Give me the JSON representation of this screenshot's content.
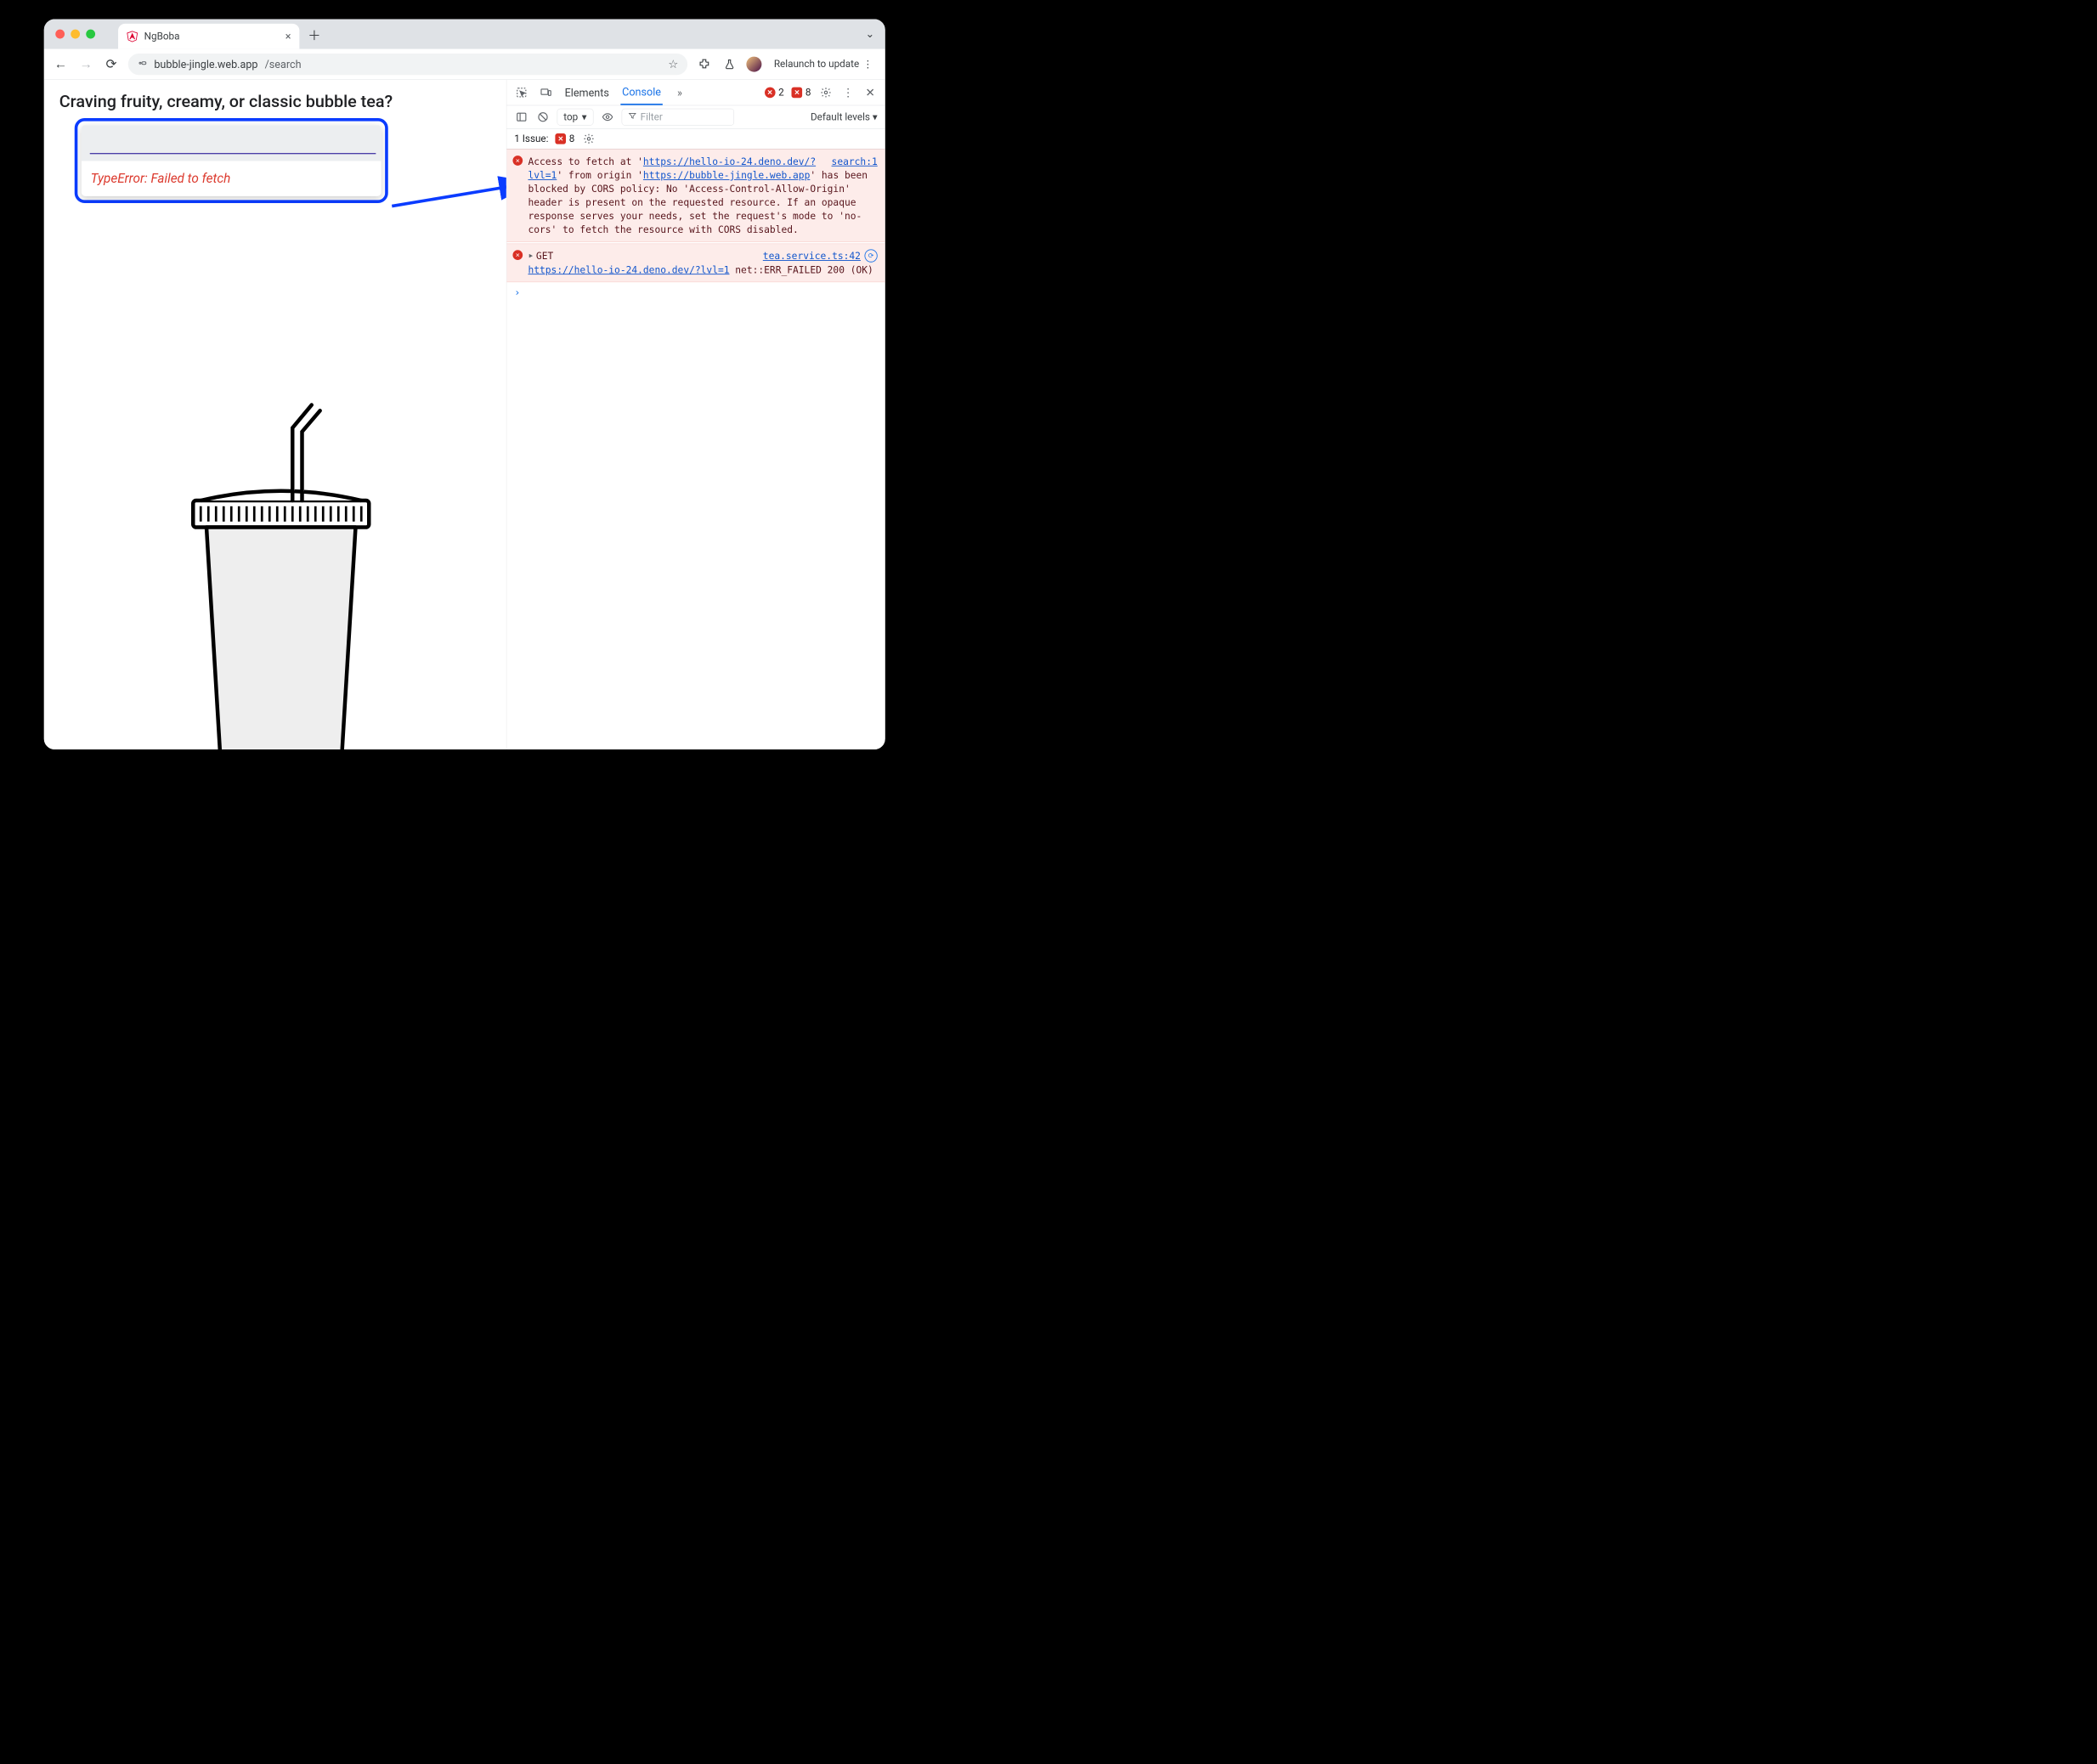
{
  "browser": {
    "tab_title": "NgBoba",
    "url_host": "bubble-jingle.web.app",
    "url_path": "/search",
    "relaunch_label": "Relaunch to update"
  },
  "page": {
    "heading": "Craving fruity, creamy, or classic bubble tea?",
    "search_value": "",
    "search_placeholder": "",
    "error_text": "TypeError: Failed to fetch"
  },
  "devtools": {
    "tabs": {
      "elements": "Elements",
      "console": "Console"
    },
    "error_count": "2",
    "issue_count": "8",
    "context_label": "top",
    "filter_placeholder": "Filter",
    "levels_label": "Default levels",
    "issues_label": "1 Issue:",
    "issues_count": "8",
    "messages": [
      {
        "source": "search:1",
        "pre": "Access to fetch at '",
        "url1": "https://hello-io-24.deno.dev/?lvl=1",
        "mid1": "' from origin '",
        "url2": "https://bubble-jingle.web.app",
        "post": "' has been blocked by CORS policy: No 'Access-Control-Allow-Origin' header is present on the requested resource. If an opaque response serves your needs, set the request's mode to 'no-cors' to fetch the resource with CORS disabled."
      },
      {
        "source": "tea.service.ts:42",
        "verb": "GET",
        "url": "https://hello-io-24.deno.dev/?lvl=1",
        "tail": " net::ERR_FAILED 200 (OK)"
      }
    ]
  }
}
